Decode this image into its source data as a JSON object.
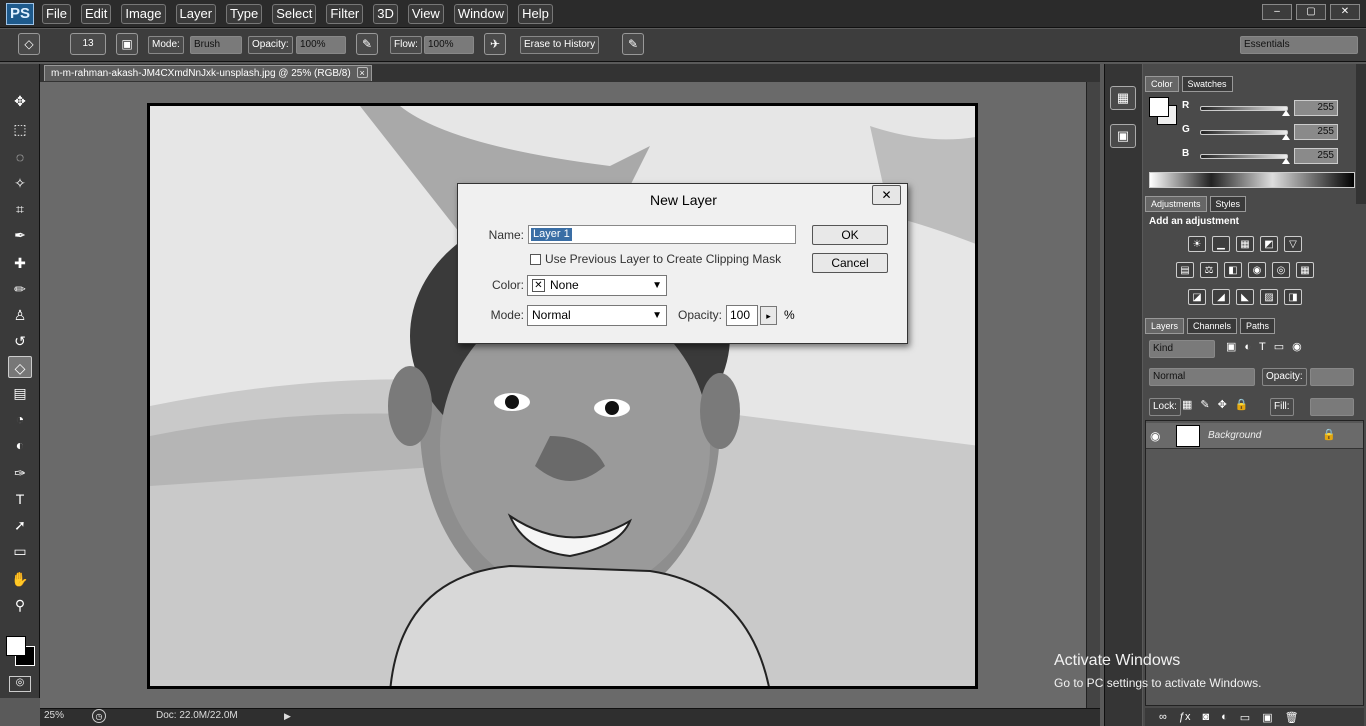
{
  "app": {
    "logo": "PS",
    "menu": [
      "File",
      "Edit",
      "Image",
      "Layer",
      "Type",
      "Select",
      "Filter",
      "3D",
      "View",
      "Window",
      "Help"
    ],
    "window_controls": [
      "–",
      "▢",
      "✕"
    ]
  },
  "options_bar": {
    "brush_size": "13",
    "mode_label": "Mode:",
    "mode_value": "Brush",
    "opacity_label": "Opacity:",
    "opacity_value": "100%",
    "flow_label": "Flow:",
    "flow_value": "100%",
    "erase_to_history": "Erase to History",
    "workspace": "Essentials"
  },
  "document": {
    "tab_title": "m-m-rahman-akash-JM4CXmdNnJxk-unsplash.jpg @ 25% (RGB/8)",
    "tab_close": "×",
    "zoom": "25%",
    "doc_info": "Doc: 22.0M/22.0M"
  },
  "panels": {
    "color_tabs": [
      "Color",
      "Swatches"
    ],
    "sliders": [
      {
        "label": "R",
        "value": "255",
        "level": 0.98
      },
      {
        "label": "G",
        "value": "255",
        "level": 0.98
      },
      {
        "label": "B",
        "value": "255",
        "level": 0.98
      }
    ],
    "adjust_tabs": [
      "Adjustments",
      "Styles"
    ],
    "add_adjustment": "Add an adjustment",
    "layers_tabs": [
      "Layers",
      "Channels",
      "Paths"
    ],
    "kind_label": "Kind",
    "blend_mode": "Normal",
    "opacity_label": "Opacity:",
    "lock_label": "Lock:",
    "fill_label": "Fill:",
    "layer_name": "Background"
  },
  "dialog": {
    "title": "New Layer",
    "close": "✕",
    "name_label": "Name:",
    "name_value": "Layer 1",
    "ok": "OK",
    "cancel": "Cancel",
    "clip_label": "Use Previous Layer to Create Clipping Mask",
    "color_label": "Color:",
    "color_value": "None",
    "mode_label": "Mode:",
    "mode_value": "Normal",
    "opacity_label": "Opacity:",
    "opacity_value": "100",
    "percent": "%"
  },
  "watermark": {
    "line1": "Activate Windows",
    "line2": "Go to PC settings to activate Windows."
  }
}
